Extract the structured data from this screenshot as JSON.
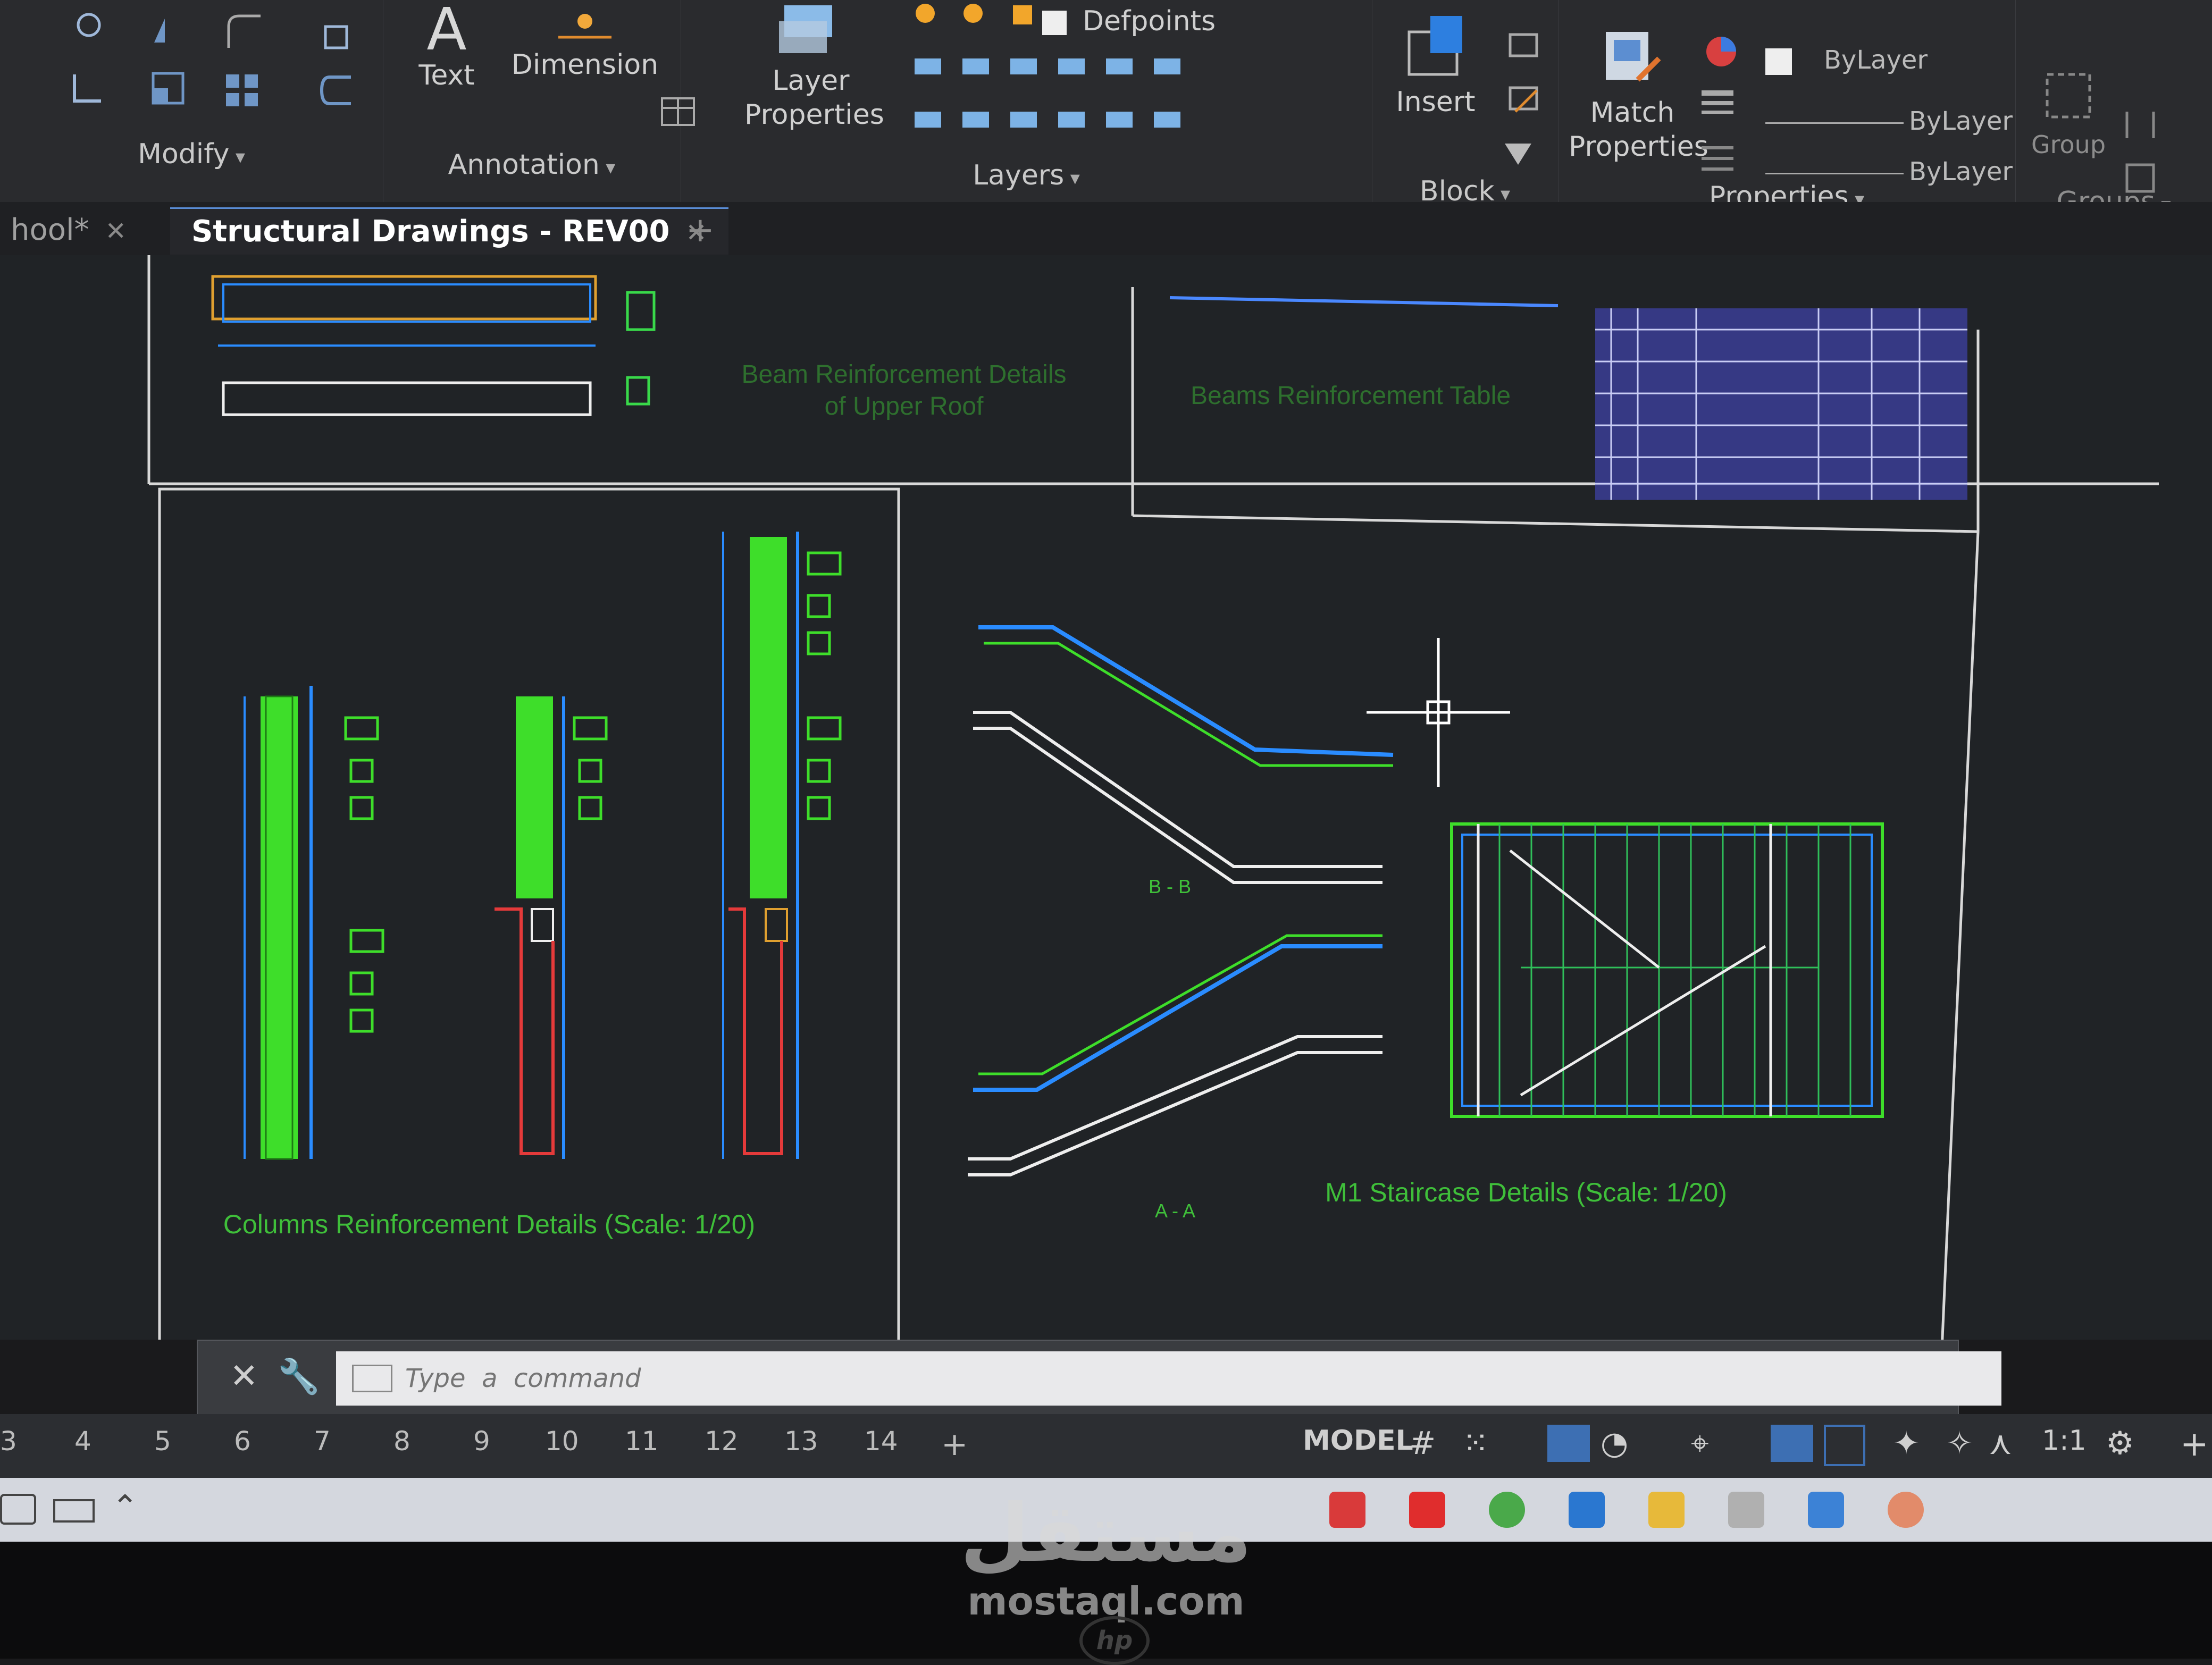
{
  "ribbon": {
    "modify": {
      "label": "Modify"
    },
    "annotation": {
      "label": "Annotation",
      "text_btn": "Text",
      "dimension_btn": "Dimension"
    },
    "layers": {
      "label": "Layers",
      "layer_properties": [
        "Layer",
        "Properties"
      ],
      "current_layer": "Defpoints"
    },
    "block": {
      "label": "Block",
      "insert_btn": "Insert"
    },
    "properties": {
      "label": "Properties",
      "match_properties": [
        "Match",
        "Properties"
      ],
      "color": "ByLayer",
      "linetype": "ByLayer",
      "lineweight": "ByLayer"
    },
    "groups": {
      "label": "Groups",
      "group_btn": "Group"
    }
  },
  "tabs": [
    {
      "label": "hool*"
    },
    {
      "label": "Structural Drawings - REV00",
      "active": true
    }
  ],
  "drawing": {
    "top_left_caption": [
      "Beam Reinforcement Details",
      "of Upper Roof"
    ],
    "top_mid_caption": "Beams Reinforcement Table",
    "columns_title": "Columns Reinforcement Details (Scale: 1/20)",
    "stair_title": "M1 Staircase Details (Scale: 1/20)",
    "section_bb": "B - B",
    "section_aa": "A - A"
  },
  "command": {
    "placeholder": "Type  a  command"
  },
  "layout_tabs": [
    "3",
    "4",
    "5",
    "6",
    "7",
    "8",
    "9",
    "10",
    "11",
    "12",
    "13",
    "14",
    "+"
  ],
  "status": {
    "model": "MODEL",
    "scale": "1:1"
  },
  "watermark": {
    "arabic": "مستقل",
    "url": "mostaql.com"
  },
  "brand": "hp",
  "colors": {
    "accent": "#5a8dd6",
    "green": "#3fe33a",
    "cyan": "#2ea3ff",
    "red": "#e43a3a"
  }
}
